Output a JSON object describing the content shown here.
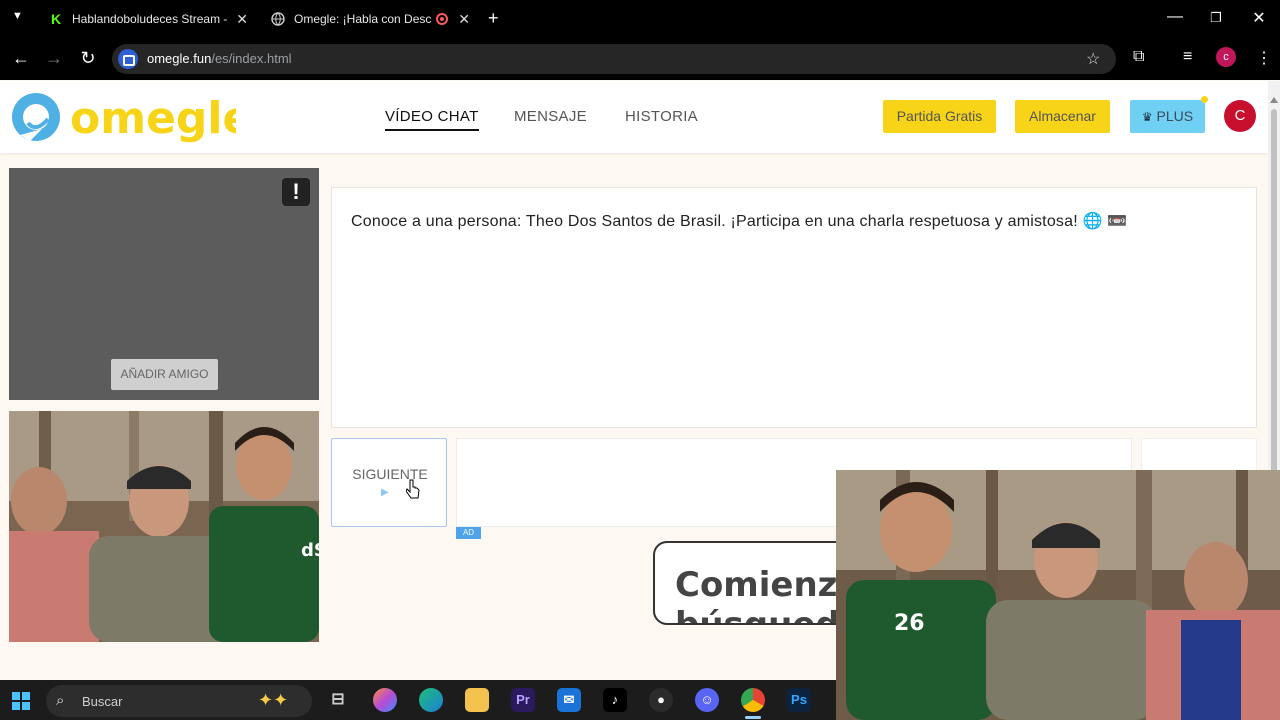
{
  "browser": {
    "tabs": [
      {
        "title": "Hablandoboludeces Stream - W",
        "favicon": "K"
      },
      {
        "title": "Omegle: ¡Habla con Descon",
        "favicon": "globe-icon"
      }
    ],
    "new_tab": "+",
    "url_host": "omegle.fun",
    "url_path": "/es/index.html",
    "profile_initial": "c"
  },
  "site": {
    "logo_text": "omegle",
    "nav": [
      {
        "label": "VÍDEO CHAT"
      },
      {
        "label": "MENSAJE"
      },
      {
        "label": "HISTORIA"
      }
    ],
    "buttons": {
      "free_game": "Partida Gratis",
      "store": "Almacenar",
      "plus": "PLUS"
    },
    "avatar_initial": "C",
    "colors": {
      "brand_blue": "#4fb0e6",
      "brand_yellow": "#f7d417",
      "plus_blue": "#6fd0f3",
      "avatar_red": "#c8102e"
    }
  },
  "main": {
    "add_friend": "AÑADIR AMIGO",
    "report_icon": "!",
    "chat_message": "Conoce a una persona: Theo Dos Santos de Brasil. ¡Participa en una charla respetuosa y amistosa! 🌐 📼",
    "next_button": "SIGUIENTE",
    "ad_label": "AD",
    "start_card_text": "Comienza\nbúsqueda"
  },
  "taskbar": {
    "search_placeholder": "Buscar",
    "apps": [
      "task-view-icon",
      "copilot-icon",
      "edge-icon",
      "file-explorer-icon",
      "premiere-icon",
      "outlook-icon",
      "tiktok-icon",
      "obs-icon",
      "discord-icon",
      "chrome-icon",
      "photoshop-icon"
    ]
  }
}
